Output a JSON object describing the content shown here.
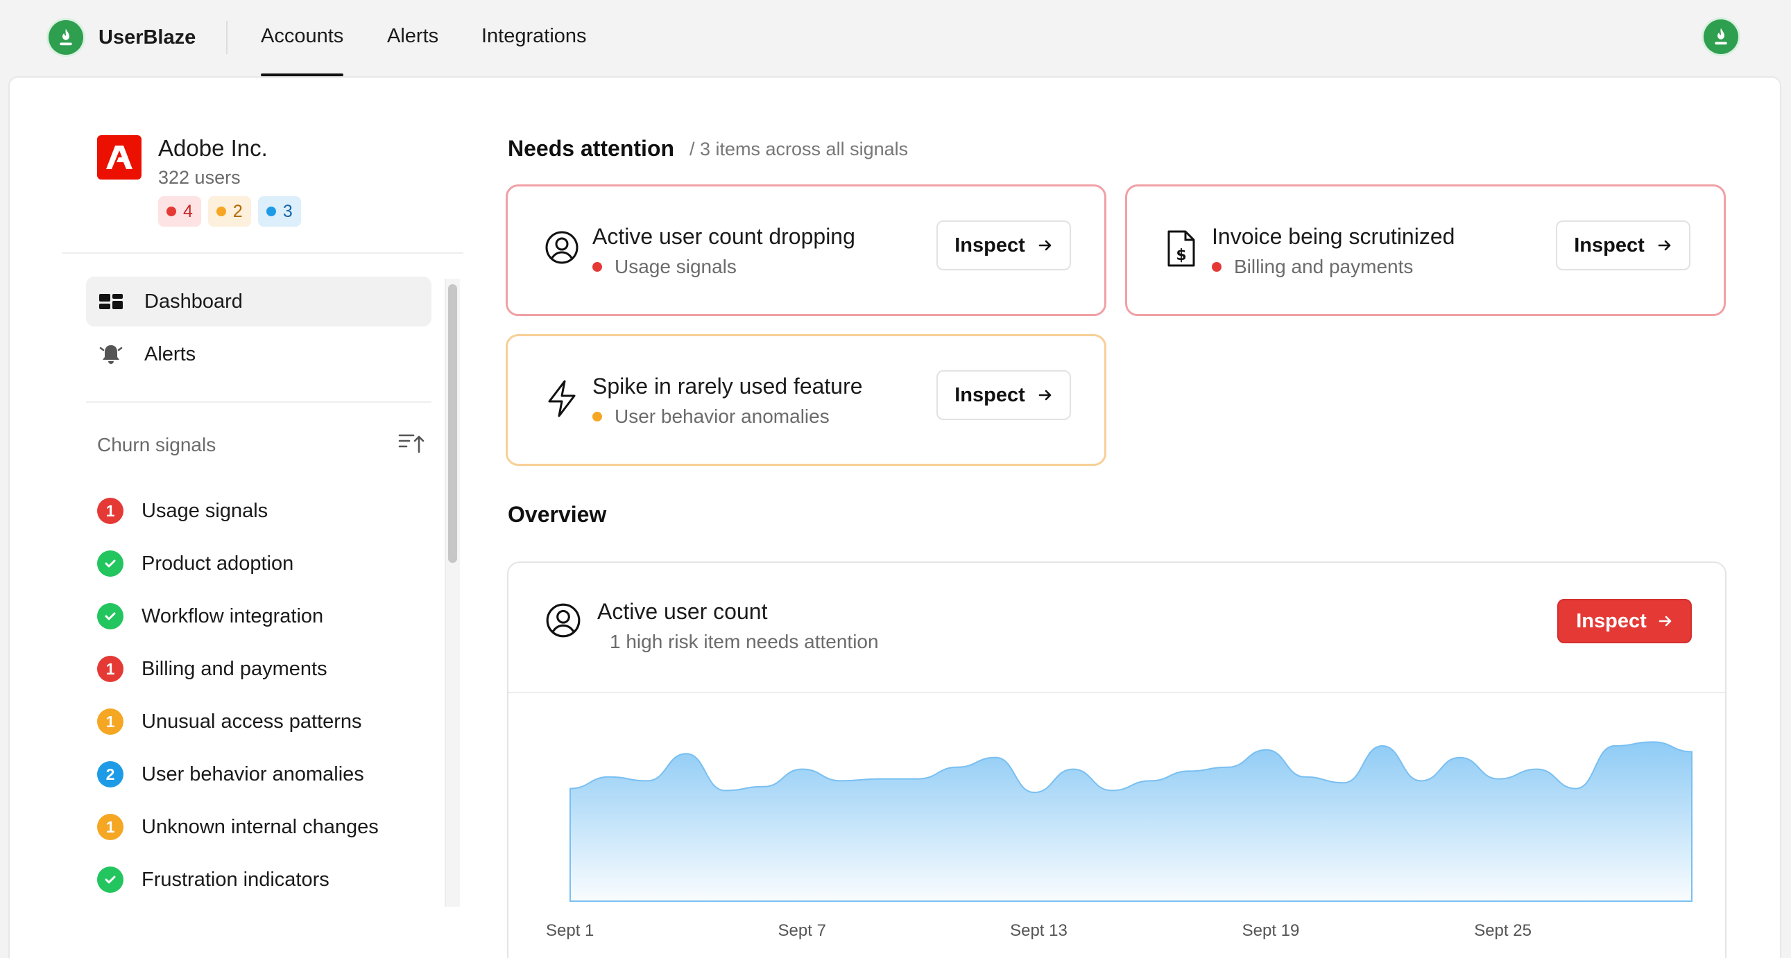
{
  "app": {
    "name": "UserBlaze"
  },
  "nav": {
    "tabs": [
      "Accounts",
      "Alerts",
      "Integrations"
    ],
    "active": "Accounts"
  },
  "account": {
    "name": "Adobe Inc.",
    "users": "322 users",
    "badges": [
      {
        "color": "red",
        "count": "4"
      },
      {
        "color": "orange",
        "count": "2"
      },
      {
        "color": "blue",
        "count": "3"
      }
    ]
  },
  "sidebar": {
    "nav": [
      {
        "label": "Dashboard",
        "icon": "dashboard-icon",
        "active": true
      },
      {
        "label": "Alerts",
        "icon": "bell-icon",
        "active": false
      }
    ],
    "churn_title": "Churn signals",
    "signals": [
      {
        "label": "Usage signals",
        "badge": "1",
        "status": "red"
      },
      {
        "label": "Product adoption",
        "badge": "",
        "status": "green"
      },
      {
        "label": "Workflow integration",
        "badge": "",
        "status": "green"
      },
      {
        "label": "Billing and payments",
        "badge": "1",
        "status": "red"
      },
      {
        "label": "Unusual access patterns",
        "badge": "1",
        "status": "orange"
      },
      {
        "label": "User behavior anomalies",
        "badge": "2",
        "status": "blue"
      },
      {
        "label": "Unknown internal changes",
        "badge": "1",
        "status": "orange"
      },
      {
        "label": "Frustration indicators",
        "badge": "",
        "status": "green"
      }
    ]
  },
  "attention": {
    "title": "Needs attention",
    "subtitle": "/ 3 items across all signals",
    "cards": [
      {
        "title": "Active user count dropping",
        "category": "Usage signals",
        "severity": "red",
        "icon": "user-circle-icon",
        "button": "Inspect"
      },
      {
        "title": "Invoice being scrutinized",
        "category": "Billing and payments",
        "severity": "red",
        "icon": "invoice-dollar-icon",
        "button": "Inspect"
      },
      {
        "title": "Spike in rarely used feature",
        "category": "User behavior anomalies",
        "severity": "orange",
        "icon": "lightning-icon",
        "button": "Inspect"
      }
    ]
  },
  "overview": {
    "title": "Overview",
    "card_title": "Active user count",
    "card_sub": "1 high risk item needs attention",
    "button": "Inspect"
  },
  "colors": {
    "brand_green": "#2e9e4f",
    "danger": "#e53935",
    "warning": "#f5a623",
    "info": "#1e9be6",
    "success": "#22c55e",
    "chart_fill": "#8ecbf5"
  },
  "chart_data": {
    "type": "area",
    "x": [
      "Sept 1",
      "Sept 2",
      "Sept 3",
      "Sept 4",
      "Sept 5",
      "Sept 6",
      "Sept 7",
      "Sept 8",
      "Sept 9",
      "Sept 10",
      "Sept 11",
      "Sept 12",
      "Sept 13",
      "Sept 14",
      "Sept 15",
      "Sept 16",
      "Sept 17",
      "Sept 18",
      "Sept 19",
      "Sept 20",
      "Sept 21",
      "Sept 22",
      "Sept 23",
      "Sept 24",
      "Sept 25",
      "Sept 26",
      "Sept 27",
      "Sept 28",
      "Sept 29",
      "Sept 30"
    ],
    "tick_labels": [
      "Sept 1",
      "Sept 7",
      "Sept 13",
      "Sept 19",
      "Sept 25"
    ],
    "values": [
      0.58,
      0.64,
      0.62,
      0.76,
      0.57,
      0.59,
      0.68,
      0.62,
      0.63,
      0.63,
      0.69,
      0.74,
      0.56,
      0.68,
      0.57,
      0.62,
      0.67,
      0.69,
      0.78,
      0.64,
      0.61,
      0.8,
      0.62,
      0.74,
      0.63,
      0.68,
      0.58,
      0.8,
      0.82,
      0.77
    ],
    "ylim": [
      0,
      1
    ],
    "grid": false,
    "legend": "none"
  }
}
